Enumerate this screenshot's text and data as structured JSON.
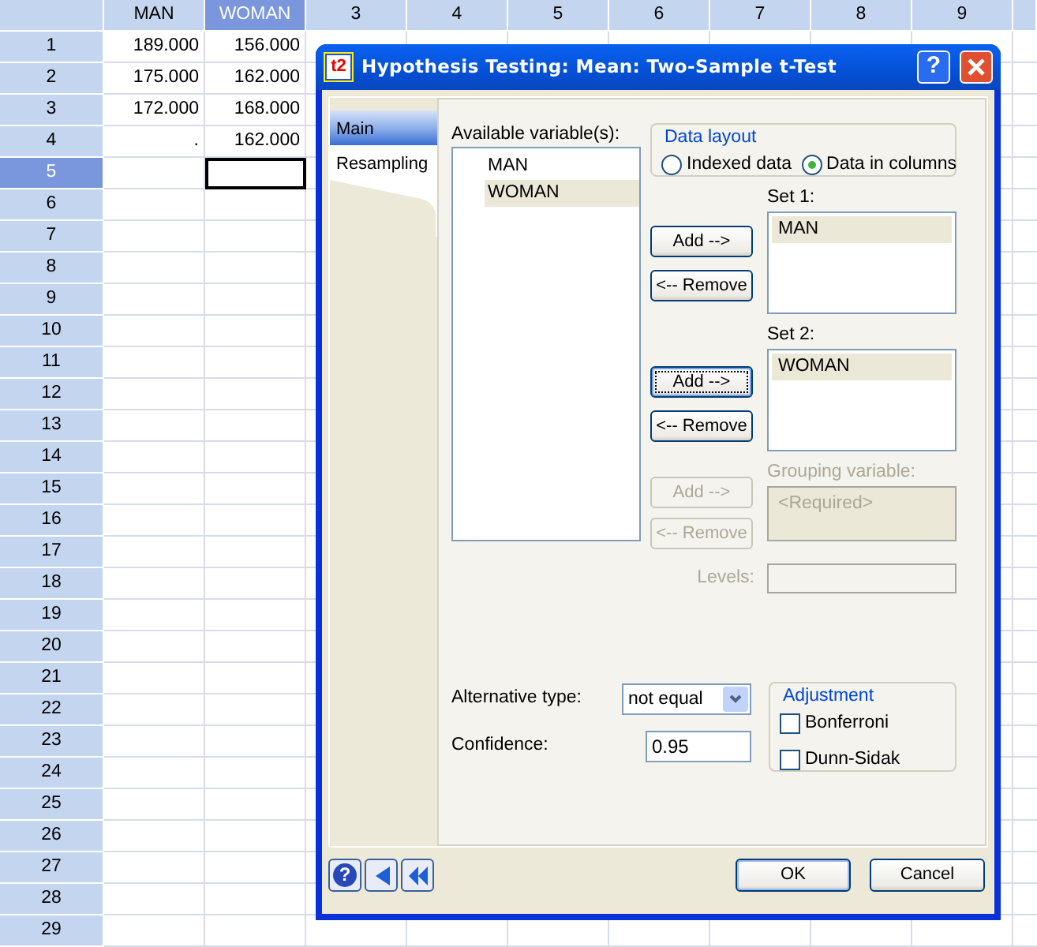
{
  "spreadsheet": {
    "columns": [
      {
        "label": "MAN",
        "selected": false
      },
      {
        "label": "WOMAN",
        "selected": true
      },
      {
        "label": "3",
        "selected": false
      },
      {
        "label": "4",
        "selected": false
      },
      {
        "label": "5",
        "selected": false
      },
      {
        "label": "6",
        "selected": false
      },
      {
        "label": "7",
        "selected": false
      },
      {
        "label": "8",
        "selected": false
      },
      {
        "label": "9",
        "selected": false
      }
    ],
    "rows": [
      {
        "label": "1",
        "selected": false,
        "cells": [
          "189.000",
          "156.000"
        ]
      },
      {
        "label": "2",
        "selected": false,
        "cells": [
          "175.000",
          "162.000"
        ]
      },
      {
        "label": "3",
        "selected": false,
        "cells": [
          "172.000",
          "168.000"
        ]
      },
      {
        "label": "4",
        "selected": false,
        "cells": [
          ".",
          "162.000"
        ]
      },
      {
        "label": "5",
        "selected": true
      },
      {
        "label": "6",
        "selected": false
      },
      {
        "label": "7",
        "selected": false
      },
      {
        "label": "8",
        "selected": false
      },
      {
        "label": "9",
        "selected": false
      },
      {
        "label": "10",
        "selected": false
      },
      {
        "label": "11",
        "selected": false
      },
      {
        "label": "12",
        "selected": false
      },
      {
        "label": "13",
        "selected": false
      },
      {
        "label": "14",
        "selected": false
      },
      {
        "label": "15",
        "selected": false
      },
      {
        "label": "16",
        "selected": false
      },
      {
        "label": "17",
        "selected": false
      },
      {
        "label": "18",
        "selected": false
      },
      {
        "label": "19",
        "selected": false
      },
      {
        "label": "20",
        "selected": false
      },
      {
        "label": "21",
        "selected": false
      },
      {
        "label": "22",
        "selected": false
      },
      {
        "label": "23",
        "selected": false
      },
      {
        "label": "24",
        "selected": false
      },
      {
        "label": "25",
        "selected": false
      },
      {
        "label": "26",
        "selected": false
      },
      {
        "label": "27",
        "selected": false
      },
      {
        "label": "28",
        "selected": false
      },
      {
        "label": "29",
        "selected": false
      }
    ]
  },
  "dialog": {
    "icon_text": "t2",
    "title": "Hypothesis Testing: Mean: Two-Sample t-Test",
    "help_glyph": "?",
    "tabs": [
      {
        "label": "Main",
        "selected": true
      },
      {
        "label": "Resampling",
        "selected": false
      }
    ],
    "available": {
      "label": "Available variable(s):",
      "items": [
        {
          "text": "MAN",
          "selected": false
        },
        {
          "text": "WOMAN",
          "selected": true
        }
      ]
    },
    "data_layout": {
      "title": "Data layout",
      "options": [
        {
          "label": "Indexed data",
          "selected": false
        },
        {
          "label": "Data in columns",
          "selected": true
        }
      ]
    },
    "sets": [
      {
        "kind": "set",
        "label": "Set 1:",
        "items": [
          {
            "text": "MAN",
            "selected": true
          }
        ],
        "add": "Add -->",
        "remove": "<-- Remove",
        "disabled": false,
        "focused": false
      },
      {
        "kind": "set",
        "label": "Set 2:",
        "items": [
          {
            "text": "WOMAN",
            "selected": true
          }
        ],
        "add": "Add -->",
        "remove": "<-- Remove",
        "disabled": false,
        "focused": true
      },
      {
        "kind": "grouping",
        "label": "Grouping variable:",
        "items": [
          {
            "text": "<Required>",
            "selected": false
          }
        ],
        "add": "Add -->",
        "remove": "<-- Remove",
        "disabled": true,
        "focused": false
      }
    ],
    "levels": {
      "label": "Levels:",
      "disabled": true
    },
    "alternative": {
      "label": "Alternative type:",
      "value": "not equal"
    },
    "confidence": {
      "label": "Confidence:",
      "value": "0.95"
    },
    "adjustment": {
      "title": "Adjustment",
      "options": [
        {
          "label": "Bonferroni",
          "checked": false
        },
        {
          "label": "Dunn-Sidak",
          "checked": false
        }
      ]
    },
    "footer_help_glyph": "?",
    "ok": "OK",
    "cancel": "Cancel"
  }
}
